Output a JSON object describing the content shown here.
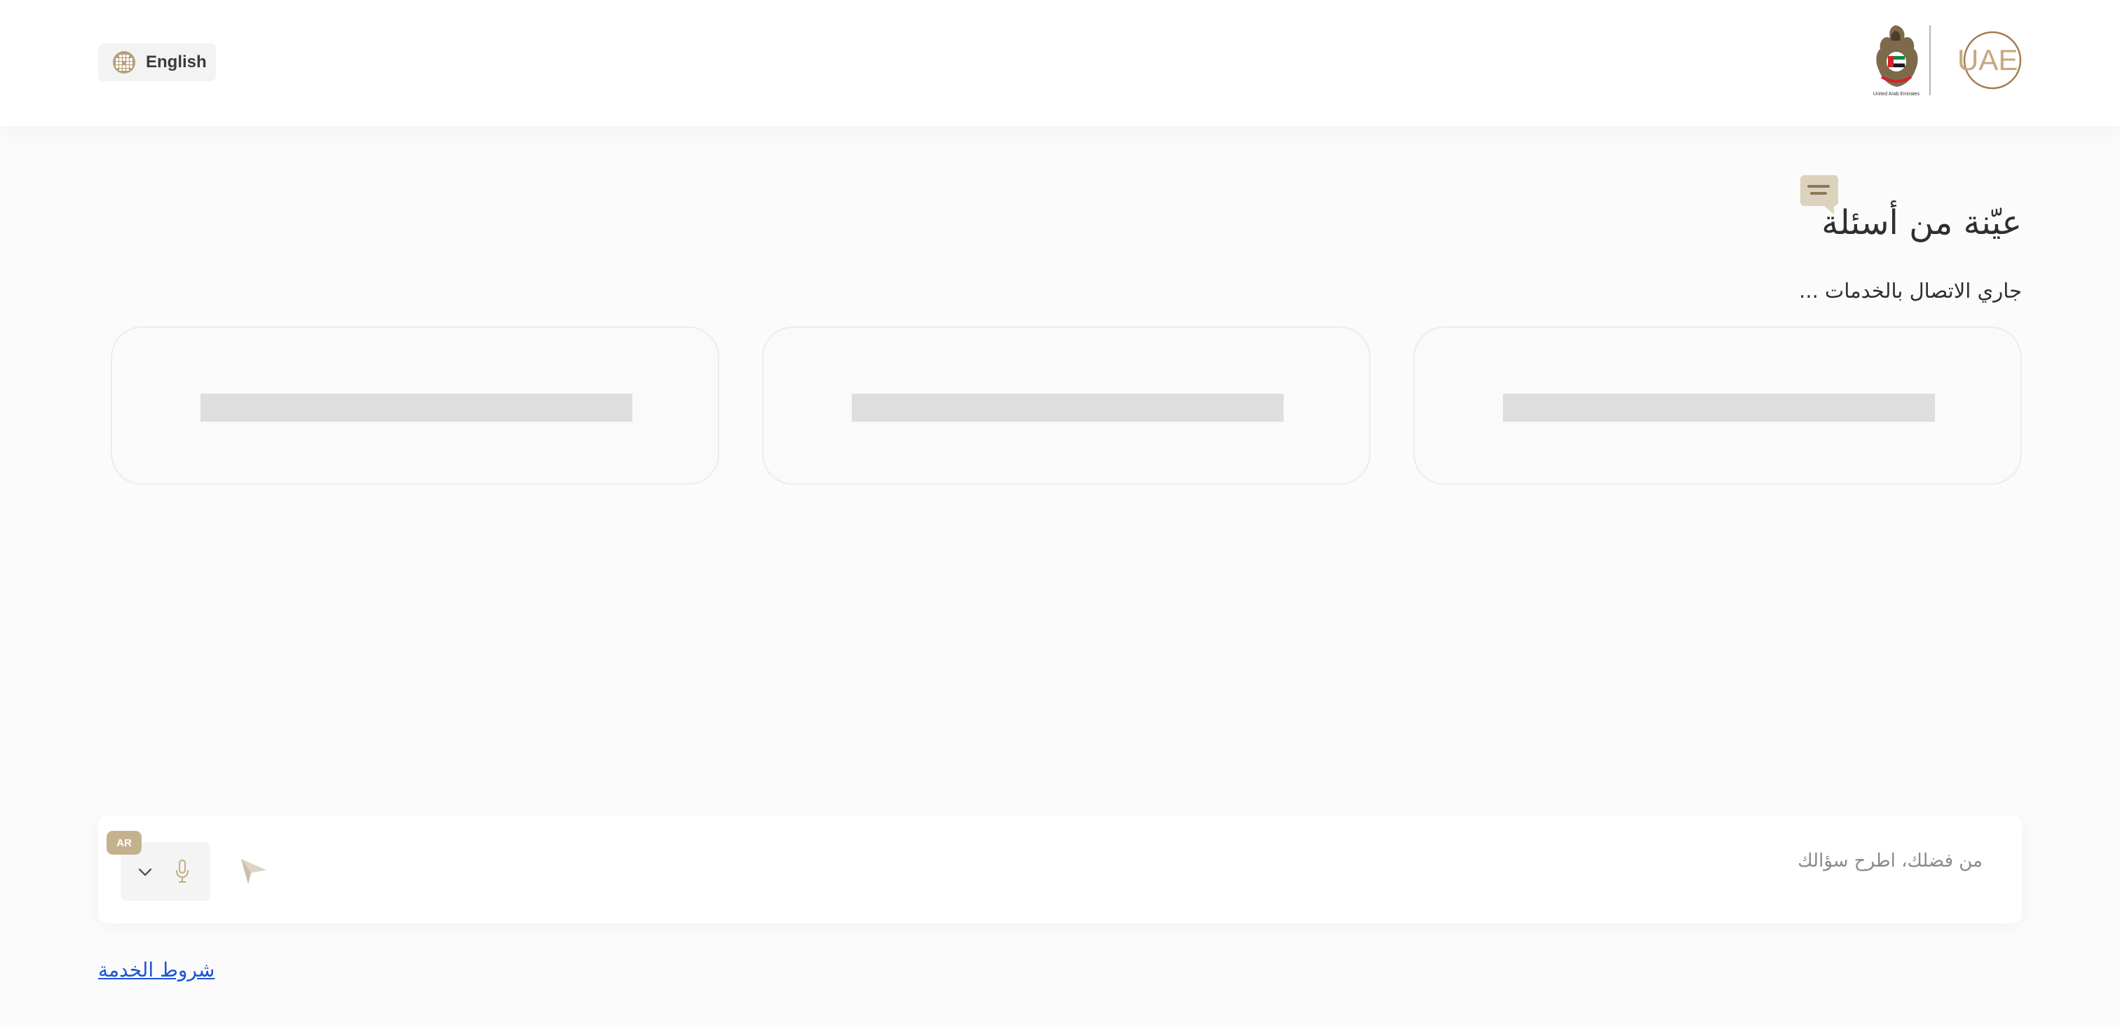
{
  "header": {
    "language_button_label": "English",
    "logo_text": "UAE"
  },
  "main": {
    "title": "عيّنة من أسئلة",
    "status": "جاري الاتصال بالخدمات ...",
    "sample_question_cards": 3
  },
  "composer": {
    "placeholder": "من فضلك، اطرح سؤالك",
    "language_badge": "AR"
  },
  "footer": {
    "terms_link": "شروط الخدمة"
  },
  "colors": {
    "accent_gold": "#c4b18e",
    "link_blue": "#1d52d8",
    "skeleton": "#dedede"
  }
}
